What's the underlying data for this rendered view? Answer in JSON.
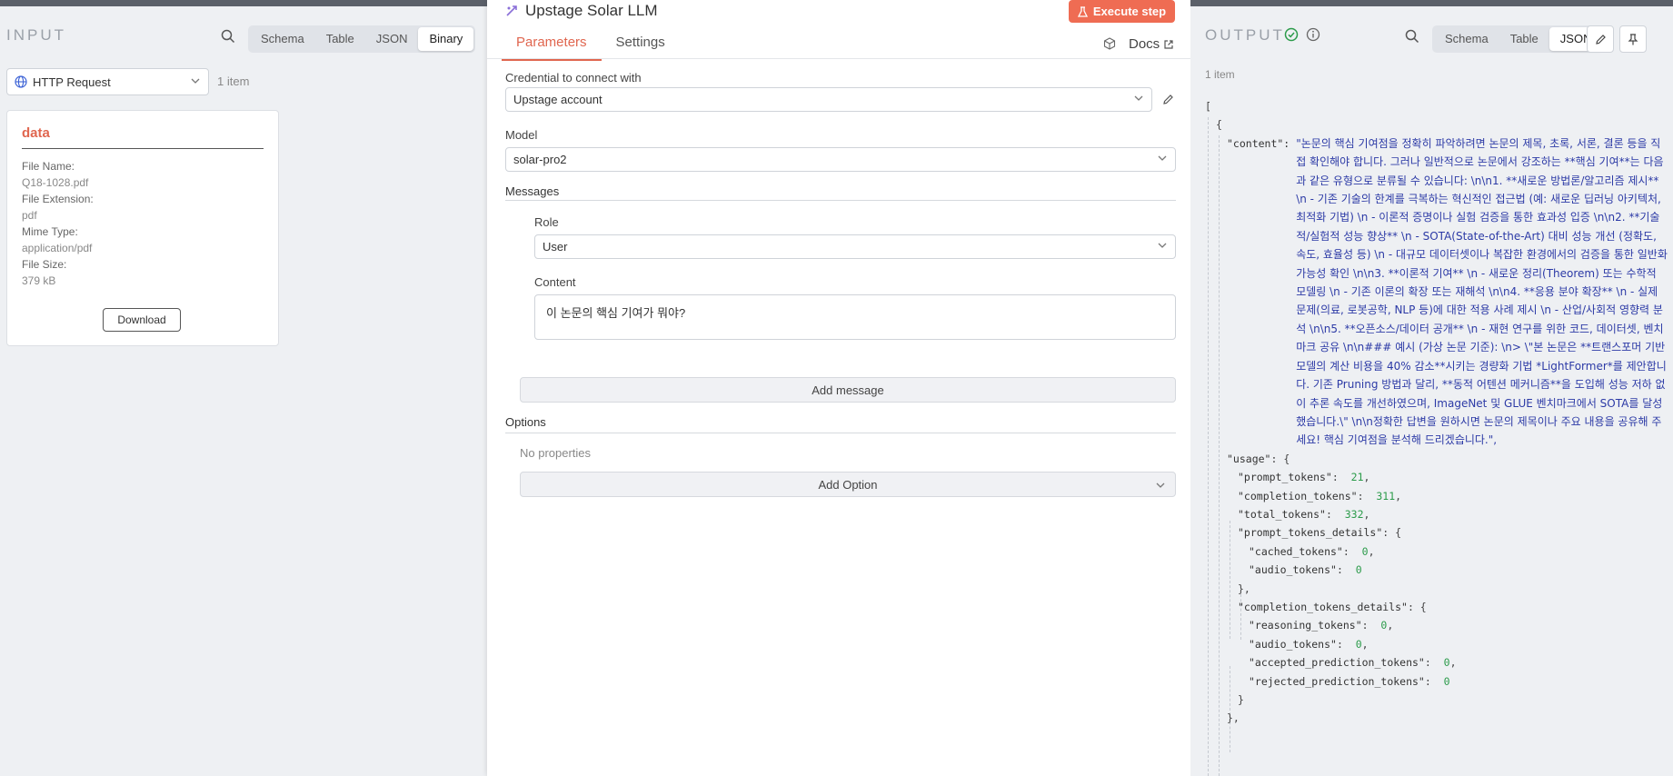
{
  "input": {
    "title": "INPUT",
    "tabs": [
      "Schema",
      "Table",
      "JSON",
      "Binary"
    ],
    "active_tab": "Binary",
    "node_select": "HTTP Request",
    "item_count": "1 item",
    "card": {
      "title": "data",
      "file_name_label": "File Name:",
      "file_name": "Q18-1028.pdf",
      "file_ext_label": "File Extension:",
      "file_ext": "pdf",
      "mime_label": "Mime Type:",
      "mime": "application/pdf",
      "size_label": "File Size:",
      "size": "379 kB",
      "download_label": "Download"
    }
  },
  "node": {
    "title": "Upstage Solar LLM",
    "execute_label": "Execute step",
    "tabs": [
      "Parameters",
      "Settings"
    ],
    "docs_label": "Docs",
    "credential_label": "Credential to connect with",
    "credential_value": "Upstage account",
    "model_label": "Model",
    "model_value": "solar-pro2",
    "messages_label": "Messages",
    "role_label": "Role",
    "role_value": "User",
    "content_label": "Content",
    "content_value": "이 논문의 핵심 기여가 뭐야?",
    "add_message_label": "Add message",
    "options_label": "Options",
    "no_properties": "No properties",
    "add_option_label": "Add Option"
  },
  "output": {
    "title": "OUTPUT",
    "tabs": [
      "Schema",
      "Table",
      "JSON"
    ],
    "active_tab": "JSON",
    "item_count": "1 item",
    "content_key": "\"content\":",
    "content_value": "\"논문의 핵심 기여점을 정확히 파악하려면 논문의 제목, 초록, 서론, 결론 등을 직접 확인해야 합니다. 그러나 일반적으로 논문에서 강조하는 **핵심 기여**는 다음과 같은 유형으로 분류될 수 있습니다: \\n\\n1. **새로운 방법론/알고리즘 제시** \\n - 기존 기술의 한계를 극복하는 혁신적인 접근법 (예: 새로운 딥러닝 아키텍처, 최적화 기법) \\n - 이론적 증명이나 실험 검증을 통한 효과성 입증 \\n\\n2. **기술적/실험적 성능 향상** \\n - SOTA(State-of-the-Art) 대비 성능 개선 (정확도, 속도, 효율성 등) \\n - 대규모 데이터셋이나 복잡한 환경에서의 검증을 통한 일반화 가능성 확인 \\n\\n3. **이론적 기여** \\n - 새로운 정리(Theorem) 또는 수학적 모델링 \\n - 기존 이론의 확장 또는 재해석 \\n\\n4. **응용 분야 확장** \\n - 실제 문제(의료, 로봇공학, NLP 등)에 대한 적용 사례 제시 \\n - 산업/사회적 영향력 분석 \\n\\n5. **오픈소스/데이터 공개** \\n - 재현 연구를 위한 코드, 데이터셋, 벤치마크 공유 \\n\\n### 예시 (가상 논문 기준): \\n> \\\"본 논문은 **트랜스포머 기반 모델의 계산 비용을 40% 감소**시키는 경량화 기법 *LightFormer*를 제안합니다. 기존 Pruning 방법과 달리, **동적 어텐션 메커니즘**을 도입해 성능 저하 없이 추론 속도를 개선하였으며, ImageNet 및 GLUE 벤치마크에서 SOTA를 달성했습니다.\\\" \\n\\n정확한 답변을 원하시면 논문의 제목이나 주요 내용을 공유해 주세요! 핵심 기여점을 분석해 드리겠습니다.\",",
    "usage": {
      "prompt_tokens": "21",
      "completion_tokens": "311",
      "total_tokens": "332",
      "cached_tokens": "0",
      "audio_tokens_prompt": "0",
      "reasoning_tokens": "0",
      "audio_tokens_completion": "0",
      "accepted_prediction_tokens": "0",
      "rejected_prediction_tokens": "0"
    }
  },
  "colors": {
    "accent": "#ef6c53",
    "tab_active": "#e0664f",
    "json_string": "#2c3aa6",
    "json_number": "#2b9b4a",
    "status_ok": "#2b9b4a"
  }
}
